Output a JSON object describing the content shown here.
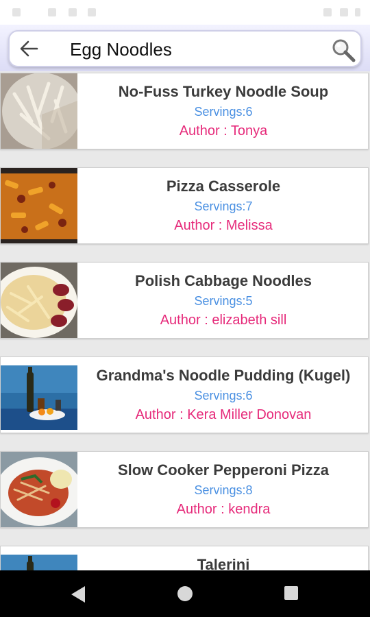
{
  "search": {
    "query": "Egg Noodles"
  },
  "recipes": [
    {
      "title": "No-Fuss Turkey Noodle Soup",
      "servings": "Servings:6",
      "author": "Author : Tonya"
    },
    {
      "title": "Pizza Casserole",
      "servings": "Servings:7",
      "author": "Author : Melissa"
    },
    {
      "title": "Polish Cabbage Noodles",
      "servings": "Servings:5",
      "author": "Author : elizabeth sill"
    },
    {
      "title": "Grandma's Noodle Pudding (Kugel)",
      "servings": "Servings:6",
      "author": "Author : Kera Miller Donovan"
    },
    {
      "title": "Slow Cooker Pepperoni Pizza",
      "servings": "Servings:8",
      "author": "Author : kendra"
    },
    {
      "title": "Talerini",
      "servings": "",
      "author": ""
    }
  ],
  "icons": {
    "back": "arrow-back-icon",
    "search": "magnifier-icon",
    "nav": [
      "back-triangle-icon",
      "home-circle-icon",
      "recents-square-icon"
    ]
  },
  "colors": {
    "servings": "#4a90e2",
    "author": "#e62a7a",
    "title": "#3b3b3b"
  }
}
